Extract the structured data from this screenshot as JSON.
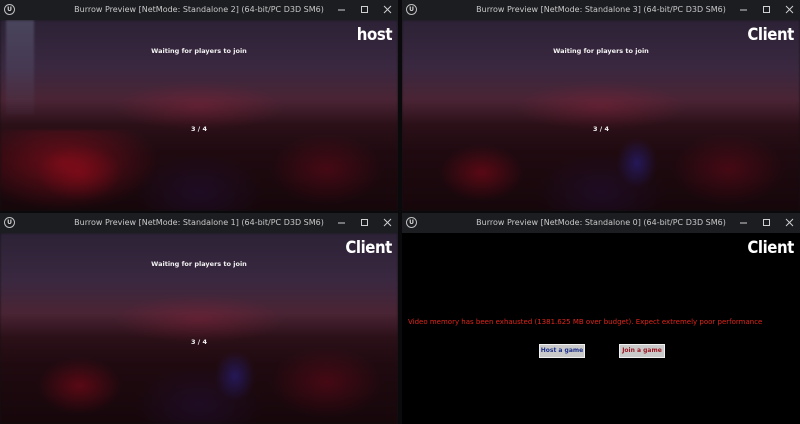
{
  "window_controls": {
    "minimize_icon": "minimize-icon",
    "maximize_icon": "maximize-icon",
    "close_icon": "close-icon"
  },
  "app_logo": {
    "text": "U",
    "icon": "unreal-logo-icon"
  },
  "windows": [
    {
      "title": "Burrow Preview [NetMode: Standalone 2]  (64-bit/PC D3D SM6)",
      "role": "host",
      "waiting": "Waiting for players to join",
      "count": "3 / 4"
    },
    {
      "title": "Burrow Preview [NetMode: Standalone 3]  (64-bit/PC D3D SM6)",
      "role": "Client",
      "waiting": "Waiting for players to join",
      "count": "3 / 4"
    },
    {
      "title": "Burrow Preview [NetMode: Standalone 1]  (64-bit/PC D3D SM6)",
      "role": "Client",
      "waiting": "Waiting for players to join",
      "count": "3 / 4"
    },
    {
      "title": "Burrow Preview [NetMode: Standalone 0]  (64-bit/PC D3D SM6)",
      "role": "Client",
      "warning": "Video memory has been exhausted (1381.625 MB over budget). Expect extremely poor performance",
      "host_button": "Host a game",
      "join_button": "Join a game"
    }
  ],
  "colors": {
    "warning": "#e0241b",
    "titlebar": "#1c1d21",
    "host_button_text": "#1b2f8a",
    "join_button_text": "#9b1520"
  }
}
